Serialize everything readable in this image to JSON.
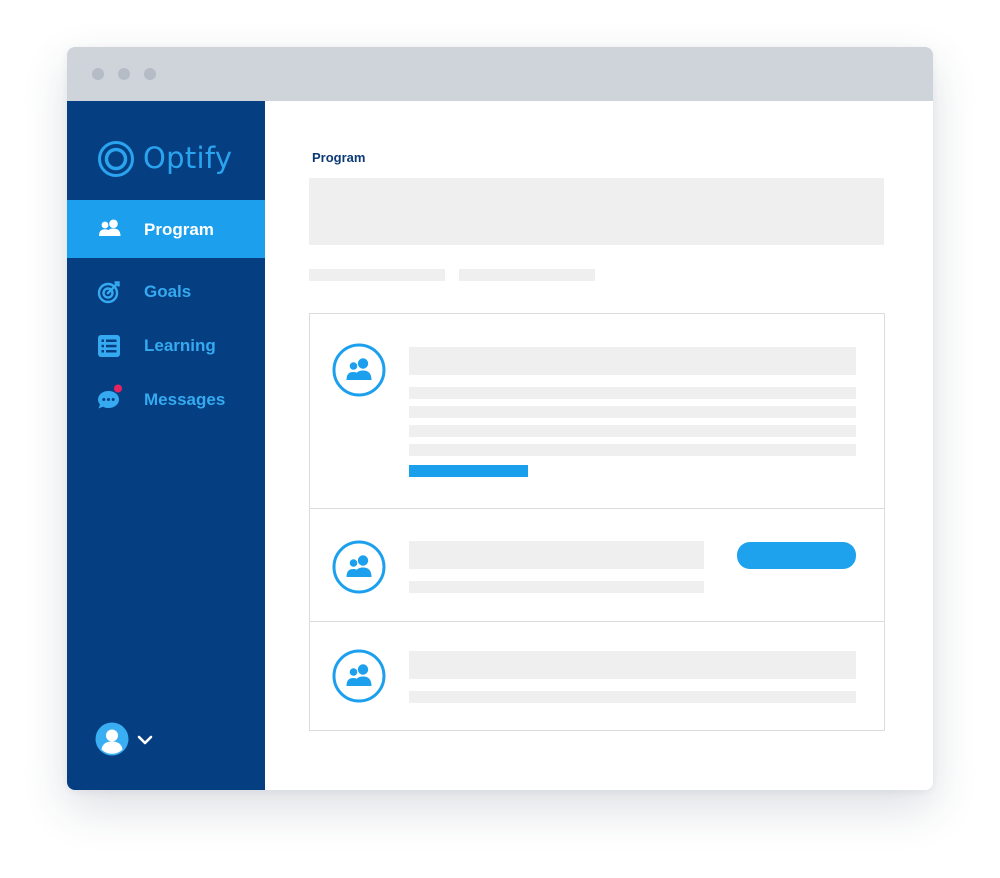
{
  "app": {
    "name": "Optify",
    "brand_color": "#1ca0ee",
    "sidebar_color": "#063e82"
  },
  "sidebar": {
    "items": [
      {
        "label": "Program",
        "icon": "people-icon",
        "active": true
      },
      {
        "label": "Goals",
        "icon": "target-icon",
        "active": false
      },
      {
        "label": "Learning",
        "icon": "list-icon",
        "active": false
      },
      {
        "label": "Messages",
        "icon": "chat-icon",
        "active": false,
        "has_notification": true
      }
    ],
    "user_menu": {
      "avatar_icon": "user-avatar-icon",
      "chevron_icon": "chevron-down-icon"
    }
  },
  "main": {
    "title": "Program",
    "cards": [
      {
        "icon": "people-icon",
        "has_link": true
      },
      {
        "icon": "people-icon",
        "has_button": true
      },
      {
        "icon": "people-icon"
      }
    ]
  },
  "colors": {
    "notification": "#e8225f",
    "placeholder": "#efefef",
    "titlebar": "#cfd3da"
  }
}
